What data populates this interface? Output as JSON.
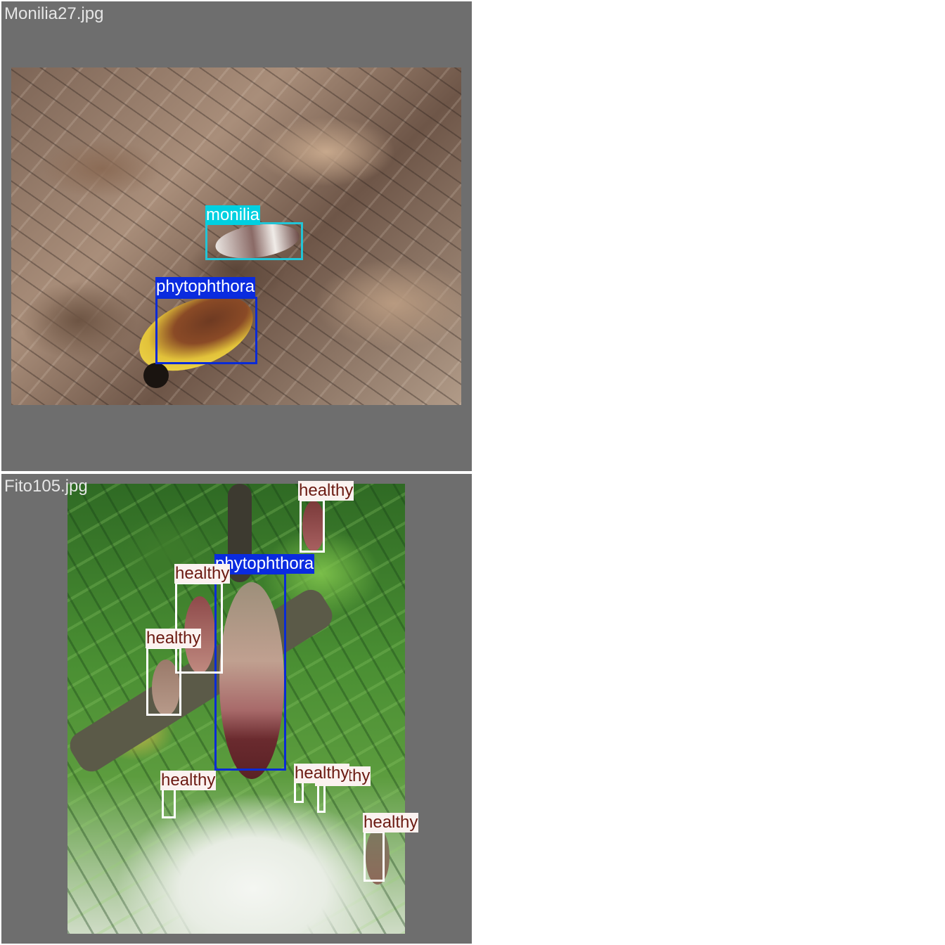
{
  "panels": [
    {
      "filename": "Monilia27.jpg",
      "detections": [
        {
          "label": "monilia"
        },
        {
          "label": "phytophthora"
        }
      ]
    },
    {
      "filename": "Fito105.jpg",
      "detections": [
        {
          "label": "healthy"
        },
        {
          "label": "phytophthora"
        },
        {
          "label": "healthy"
        },
        {
          "label": "healthy"
        },
        {
          "label": "healthy"
        },
        {
          "label": "healthy"
        },
        {
          "label": "healthy"
        },
        {
          "label": "healthy"
        }
      ]
    }
  ],
  "colors": {
    "monilia": "#00d0e0",
    "phytophthora": "#0a2be0",
    "healthy": "#ffffff",
    "panel_background": "#6e6e6e"
  }
}
